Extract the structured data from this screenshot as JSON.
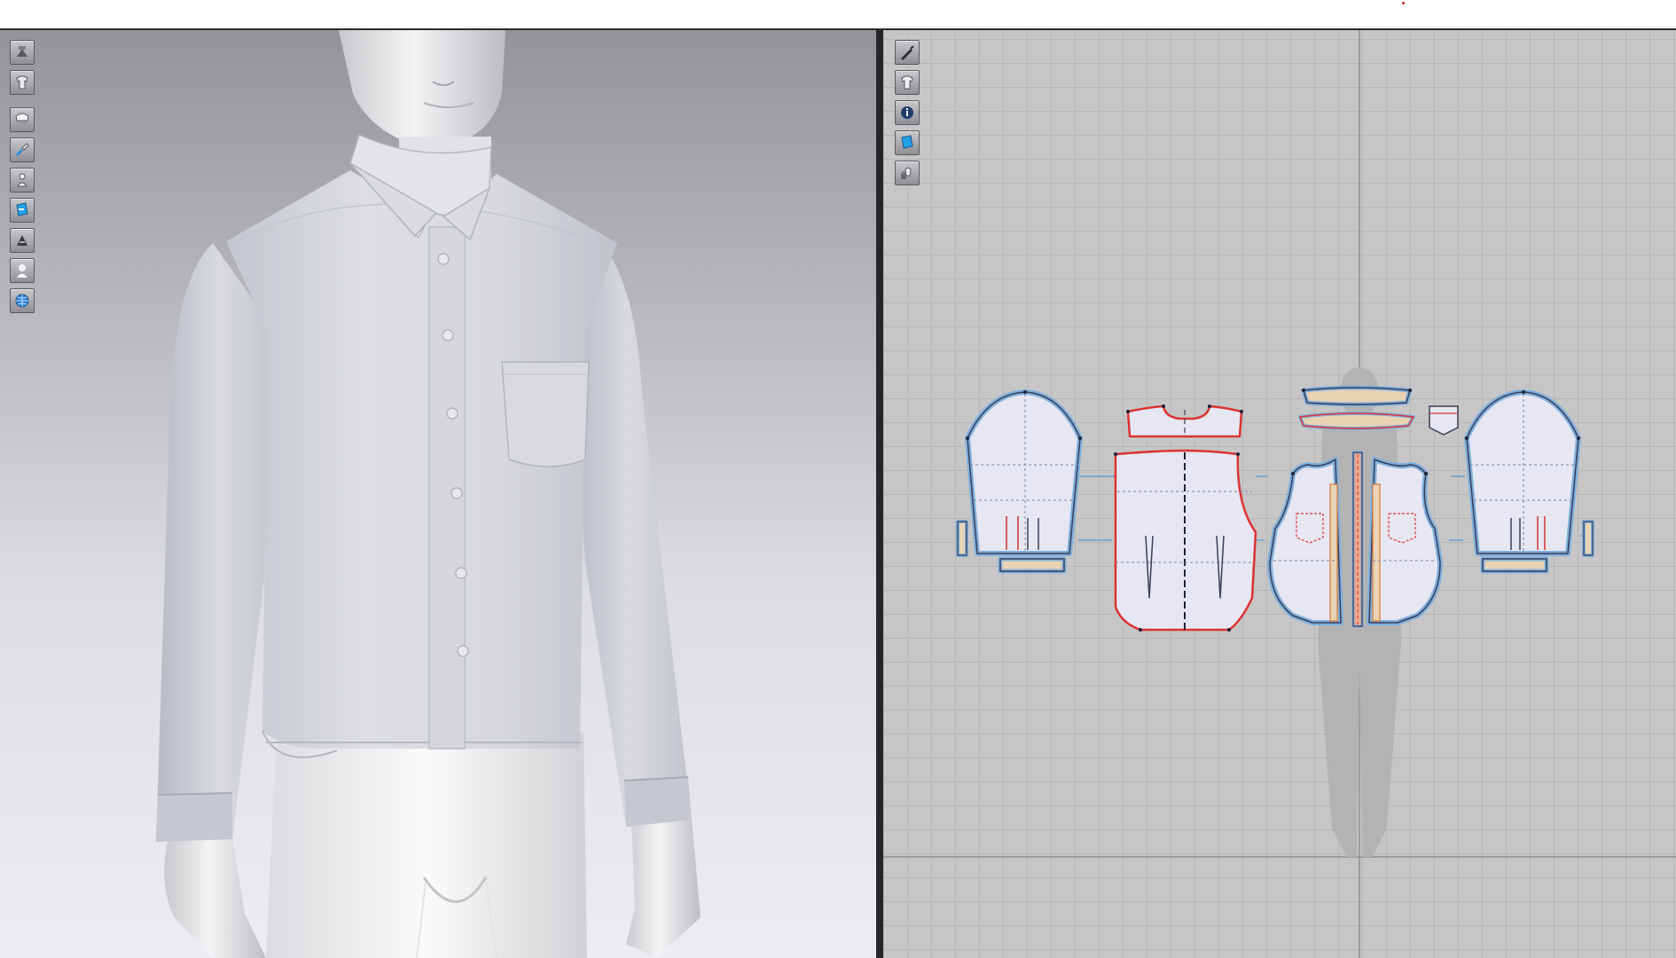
{
  "app": {
    "accent_red": "#dd3333",
    "accent_blue": "#7fb0dd"
  },
  "viewport_3d": {
    "toolbar": [
      {
        "icon": "garment-display-icon"
      },
      {
        "icon": "shirt-display-icon"
      },
      {
        "icon": "fabric-display-icon"
      },
      {
        "icon": "texture-paint-icon"
      },
      {
        "icon": "avatar-display-icon"
      },
      {
        "icon": "fabric-color-icon"
      },
      {
        "icon": "surface-render-icon"
      },
      {
        "icon": "avatar-silhouette-icon"
      },
      {
        "icon": "globe-environment-icon"
      }
    ]
  },
  "viewport_2d": {
    "toolbar": [
      {
        "icon": "pen-tool-icon"
      },
      {
        "icon": "shirt-pattern-icon"
      },
      {
        "icon": "info-icon"
      },
      {
        "icon": "fabric-texture-icon"
      },
      {
        "icon": "lock-pattern-icon"
      }
    ]
  }
}
